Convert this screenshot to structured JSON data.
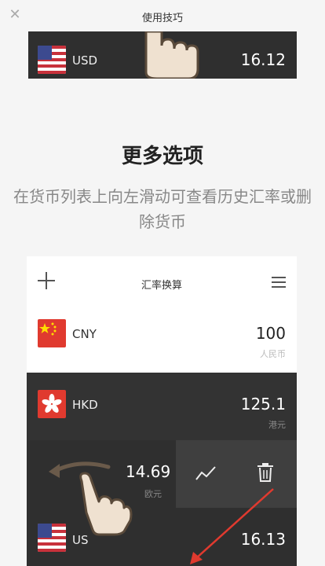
{
  "topbar": {
    "title": "使用技巧",
    "close_glyph": "✕"
  },
  "preview_top": {
    "code": "USD",
    "amount": "16.12"
  },
  "heading": "更多选项",
  "description": "在货币列表上向左滑动可查看历史汇率或删除货币",
  "app": {
    "title": "汇率换算",
    "rows": [
      {
        "code": "CNY",
        "amount": "100",
        "name": "人民币",
        "flag": "cn-flag-icon"
      },
      {
        "code": "HKD",
        "amount": "125.1",
        "name": "港元",
        "flag": "hk-flag-icon"
      },
      {
        "code": "",
        "amount": "14.69",
        "name": "欧元",
        "flag": ""
      },
      {
        "code": "US",
        "amount": "16.13",
        "name": "",
        "flag": "us-flag-icon"
      }
    ]
  },
  "colors": {
    "accent_red": "#e03a2f",
    "dark_row": "#2f2f2f",
    "hand_skin": "#efe1d0"
  }
}
